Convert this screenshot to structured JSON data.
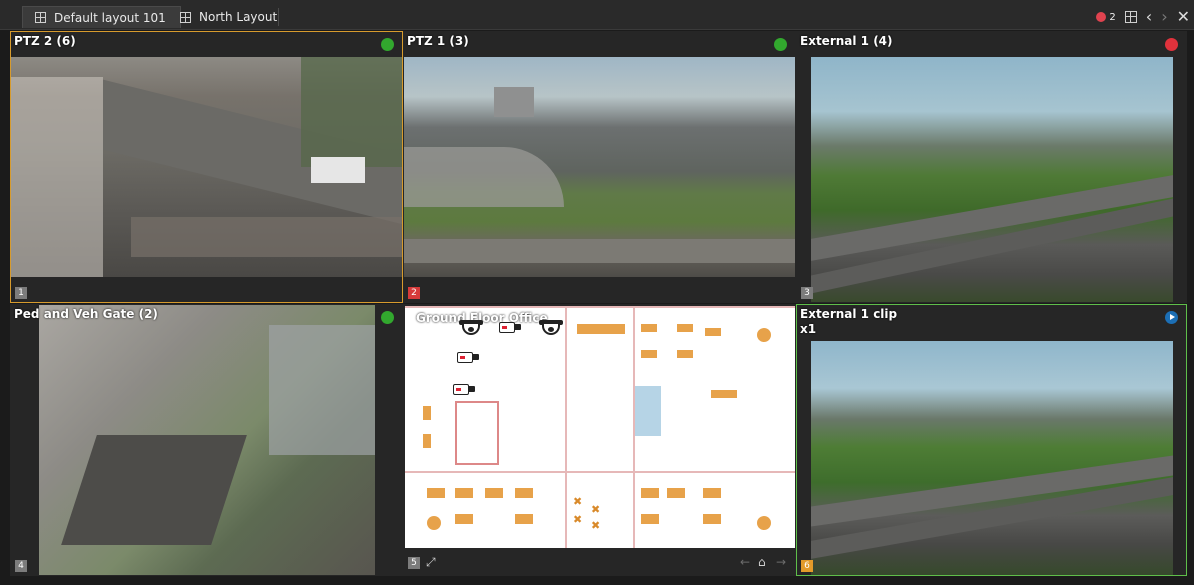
{
  "tabs": [
    {
      "label": "Default layout 101",
      "active": true
    },
    {
      "label": "North Layout",
      "active": false
    }
  ],
  "toolbar": {
    "alarm_count": "2",
    "icons": [
      "alarm-icon",
      "layout-grid-icon",
      "previous-icon",
      "next-icon",
      "close-icon"
    ]
  },
  "tiles": [
    {
      "title": "PTZ 2 (6)",
      "number": "1",
      "status": "online"
    },
    {
      "title": "PTZ 1 (3)",
      "number": "2",
      "status": "online"
    },
    {
      "title": "External 1 (4)",
      "number": "3",
      "status": "recording"
    },
    {
      "title": "Ped and Veh Gate (2)",
      "number": "4",
      "status": "online"
    },
    {
      "title": "Ground Floor Office",
      "number": "5",
      "status": "map"
    },
    {
      "title": "External 1 clip",
      "subtitle": "x1",
      "number": "6",
      "status": "playback"
    }
  ],
  "colors": {
    "selected_tile_border": "#d79b2d",
    "playback_tile_border": "#5fbf4a",
    "online": "#32a82e",
    "recording": "#e0323c",
    "playback": "#1c6fb5",
    "alarm": "#e0434f"
  }
}
